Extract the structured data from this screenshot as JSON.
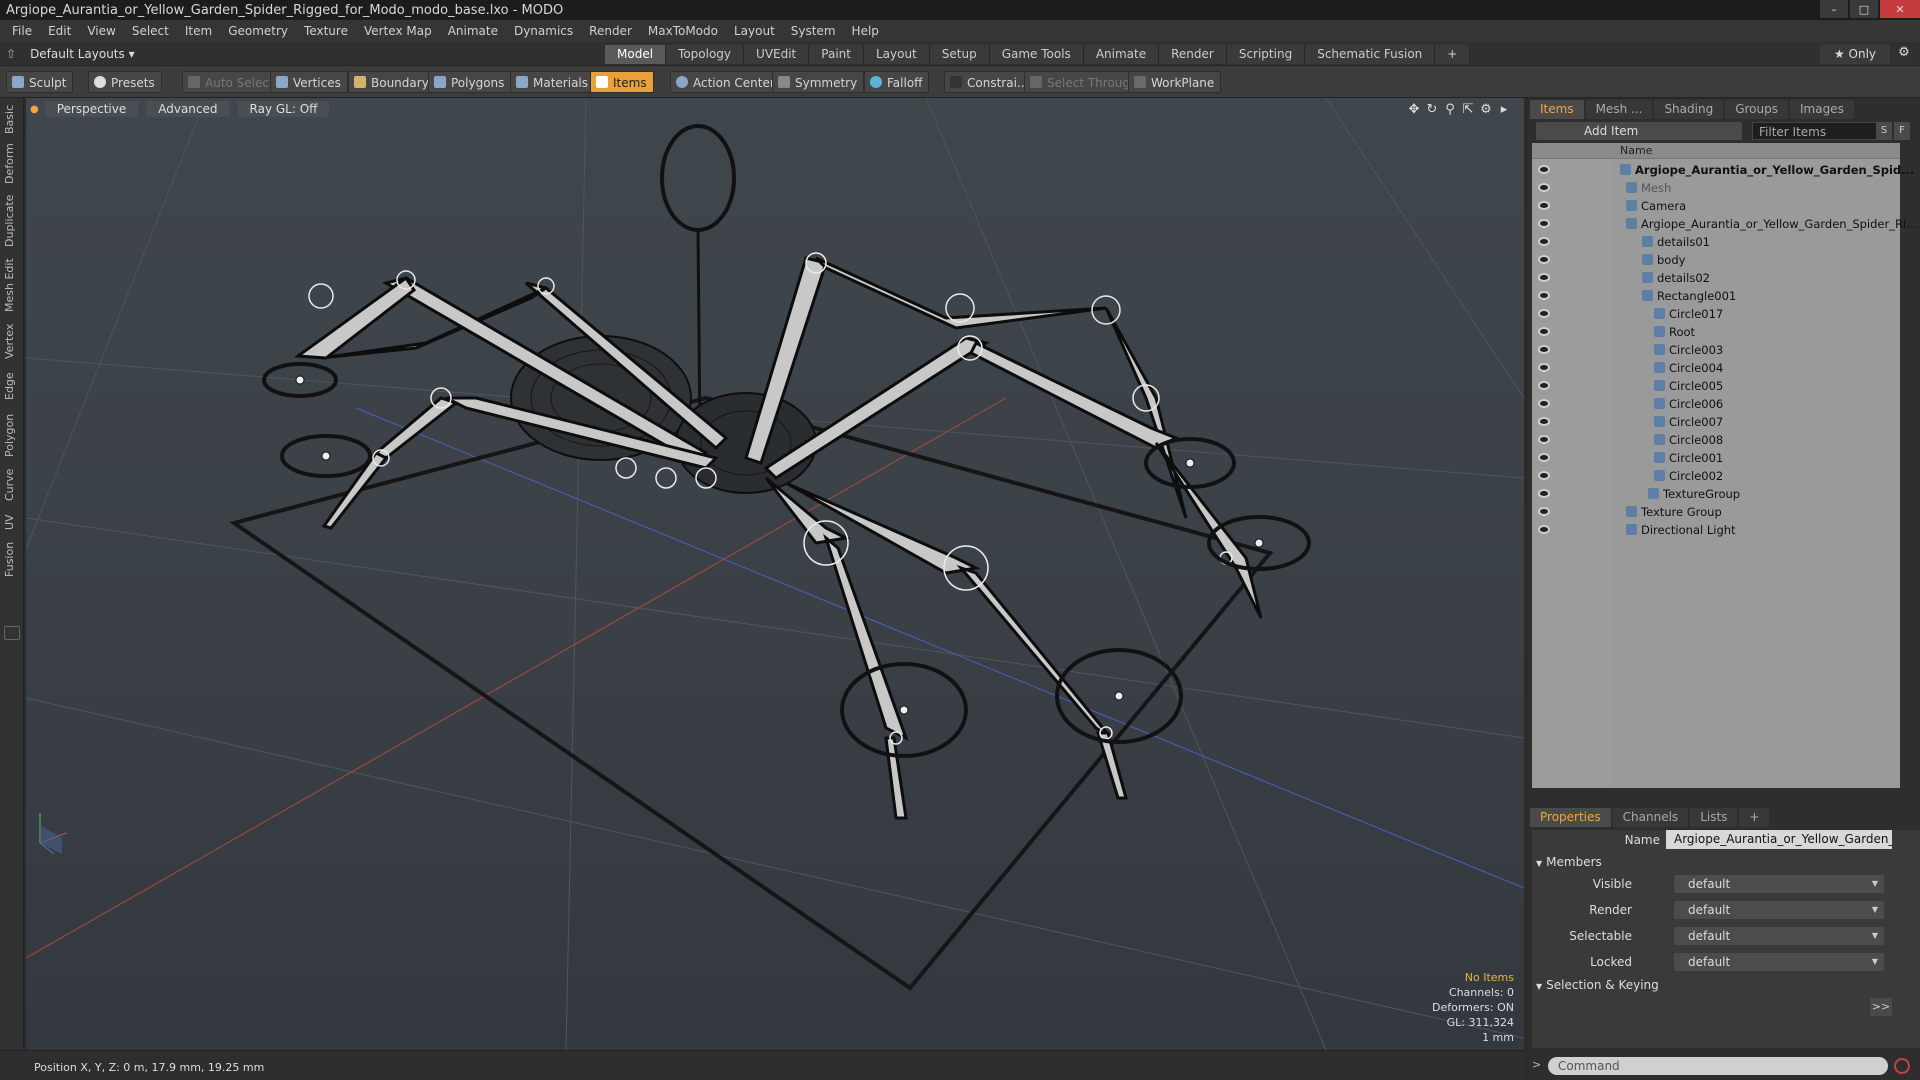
{
  "window": {
    "title": "Argiope_Aurantia_or_Yellow_Garden_Spider_Rigged_for_Modo_modo_base.lxo - MODO",
    "btn_min": "–",
    "btn_max": "□",
    "btn_close": "✕"
  },
  "menu": [
    "File",
    "Edit",
    "View",
    "Select",
    "Item",
    "Geometry",
    "Texture",
    "Vertex Map",
    "Animate",
    "Dynamics",
    "Render",
    "MaxToModo",
    "Layout",
    "System",
    "Help"
  ],
  "layouts_label": "Default Layouts ▾",
  "mode_tabs": [
    {
      "label": "Model",
      "active": true
    },
    {
      "label": "Topology"
    },
    {
      "label": "UVEdit"
    },
    {
      "label": "Paint"
    },
    {
      "label": "Layout"
    },
    {
      "label": "Setup"
    },
    {
      "label": "Game Tools"
    },
    {
      "label": "Animate"
    },
    {
      "label": "Render"
    },
    {
      "label": "Scripting"
    },
    {
      "label": "Schematic Fusion"
    },
    {
      "label": "+"
    }
  ],
  "only_label": "★ Only",
  "toolbar": {
    "sculpt": "Sculpt",
    "presets": "Presets",
    "auto_select": "Auto Select",
    "vertices": "Vertices",
    "boundary": "Boundary",
    "polygons": "Polygons",
    "materials": "Materials",
    "items": "Items",
    "action_center": "Action Center",
    "symmetry": "Symmetry",
    "falloff": "Falloff",
    "constraints": "Constrai...",
    "select_through": "Select Through",
    "workplane": "WorkPlane"
  },
  "left_tabs": [
    "Basic",
    "Deform",
    "Duplicate",
    "Mesh Edit",
    "Vertex",
    "Edge",
    "Polygon",
    "Curve",
    "UV",
    "Fusion"
  ],
  "viewport": {
    "perspective": "Perspective",
    "advanced": "Advanced",
    "raygl": "Ray GL: Off",
    "info": {
      "no_items": "No Items",
      "channels": "Channels: 0",
      "deformers": "Deformers: ON",
      "gl": "GL: 311,324",
      "unit": "1 mm"
    }
  },
  "status": "Position X, Y, Z:  0 m, 17.9 mm, 19.25 mm",
  "items_panel": {
    "tabs": [
      "Items",
      "Mesh ...",
      "Shading",
      "Groups",
      "Images"
    ],
    "add_item": "Add Item",
    "filter": "Filter Items",
    "s": "S",
    "f": "F",
    "col_name": "Name",
    "rows": [
      {
        "label": "Argiope_Aurantia_or_Yellow_Garden_Spid...",
        "root": true
      },
      {
        "label": "Mesh",
        "dim": true
      },
      {
        "label": "Camera"
      },
      {
        "label": "Argiope_Aurantia_or_Yellow_Garden_Spider_Ri..."
      },
      {
        "label": "details01"
      },
      {
        "label": "body"
      },
      {
        "label": "details02"
      },
      {
        "label": "Rectangle001"
      },
      {
        "label": "Circle017"
      },
      {
        "label": "Root"
      },
      {
        "label": "Circle003"
      },
      {
        "label": "Circle004"
      },
      {
        "label": "Circle005"
      },
      {
        "label": "Circle006"
      },
      {
        "label": "Circle007"
      },
      {
        "label": "Circle008"
      },
      {
        "label": "Circle001"
      },
      {
        "label": "Circle002"
      },
      {
        "label": "TextureGroup"
      },
      {
        "label": "Texture Group"
      },
      {
        "label": "Directional Light"
      }
    ]
  },
  "properties": {
    "tabs": [
      "Properties",
      "Channels",
      "Lists",
      "+"
    ],
    "name_label": "Name",
    "name_value": "Argiope_Aurantia_or_Yellow_Garden_Spider",
    "members": "Members",
    "visible": "Visible",
    "render": "Render",
    "selectable": "Selectable",
    "locked": "Locked",
    "default": "default",
    "selection_keying": "Selection & Keying",
    "more": ">>"
  },
  "command_placeholder": "Command",
  "colors": {
    "accent": "#f0a640",
    "items_active": "#e9a036"
  }
}
